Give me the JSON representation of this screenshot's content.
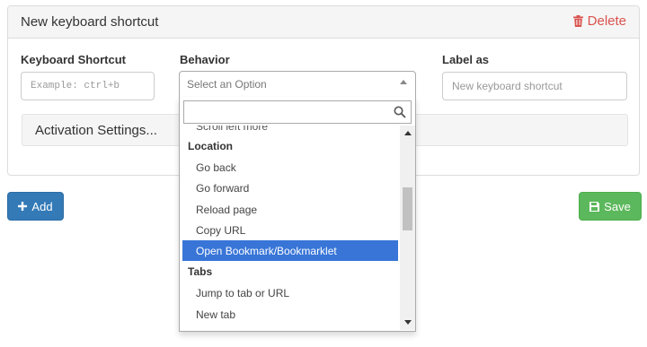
{
  "panel": {
    "title": "New keyboard shortcut",
    "delete_label": "Delete"
  },
  "fields": {
    "shortcut_label": "Keyboard Shortcut",
    "shortcut_placeholder": "Example: ctrl+b",
    "behavior_label": "Behavior",
    "behavior_placeholder": "Select an Option",
    "label_as_label": "Label as",
    "label_as_placeholder": "New keyboard shortcut"
  },
  "activation": {
    "label": "Activation Settings..."
  },
  "dropdown": {
    "search_value": "",
    "partial_item": "Scroll left more",
    "groups": [
      {
        "label": "Location",
        "items": [
          "Go back",
          "Go forward",
          "Reload page",
          "Copy URL",
          "Open Bookmark/Bookmarklet"
        ]
      },
      {
        "label": "Tabs",
        "items": [
          "Jump to tab or URL",
          "New tab"
        ]
      }
    ],
    "selected_item": "Open Bookmark/Bookmarklet"
  },
  "buttons": {
    "add_label": "Add",
    "save_label": "Save"
  },
  "colors": {
    "delete": "#d9534f",
    "add": "#337ab7",
    "save": "#5cb85c",
    "selected": "#3875d7"
  },
  "icons": {
    "delete": "trash-icon",
    "add": "plus-icon",
    "save": "floppy-disk-icon",
    "search": "search-icon"
  }
}
